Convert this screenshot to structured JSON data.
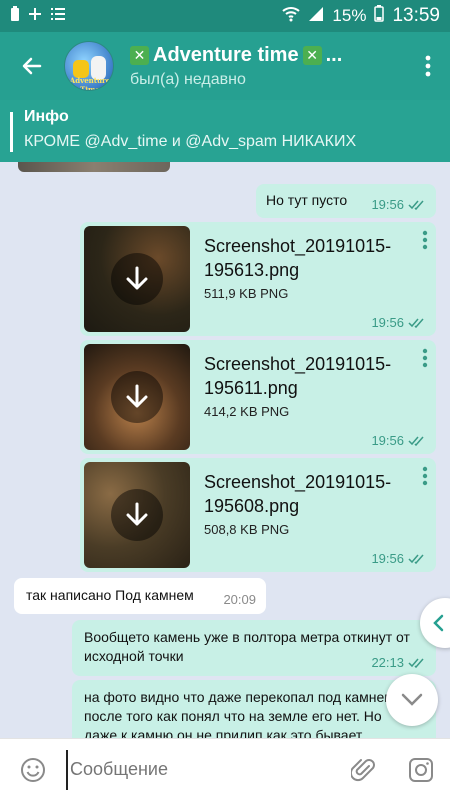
{
  "status_bar": {
    "battery": "15%",
    "time": "13:59"
  },
  "header": {
    "title": "Adventure time",
    "title_suffix": "...",
    "subtitle": "был(а) недавно",
    "avatar_text": "Adventure Time",
    "title_icon_color": "#4caf50"
  },
  "pinned": {
    "title": "Инфо",
    "text": "КРОМЕ @Adv_time и @Adv_spam НИКАКИХ"
  },
  "messages": [
    {
      "type": "out",
      "text": "Но тут пусто",
      "time": "19:56"
    },
    {
      "type": "file",
      "name": "Screenshot_20191015-195613.png",
      "size": "511,9 KB PNG",
      "time": "19:56"
    },
    {
      "type": "file",
      "name": "Screenshot_20191015-195611.png",
      "size": "414,2 KB PNG",
      "time": "19:56"
    },
    {
      "type": "file",
      "name": "Screenshot_20191015-195608.png",
      "size": "508,8 KB PNG",
      "time": "19:56"
    },
    {
      "type": "in",
      "text": "так написано Под камнем",
      "time": "20:09"
    },
    {
      "type": "out",
      "text": "Вообщето камень уже в полтора метра откинут от исходной точки",
      "time": "22:13"
    },
    {
      "type": "out",
      "text": "на фото видно что даже перекопал под камнем после того как понял что на земле его нет. Но даже к камню он не прилип как это бывает",
      "time": ""
    }
  ],
  "input": {
    "placeholder": "Сообщение"
  },
  "colors": {
    "header": "#26a091",
    "status": "#1f8a7c",
    "outgoing": "#c8f0e6",
    "chat_bg": "#dfe5f2",
    "accent": "#3a9b87"
  }
}
